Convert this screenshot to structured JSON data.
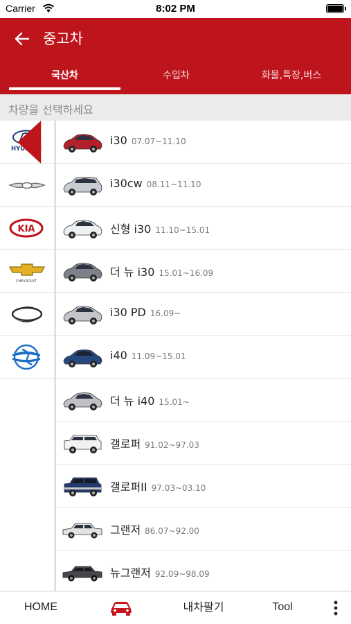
{
  "status_bar": {
    "carrier": "Carrier",
    "time": "8:02 PM"
  },
  "header": {
    "title": "중고차",
    "tabs": [
      {
        "label": "국산차",
        "selected": true
      },
      {
        "label": "수입차",
        "selected": false
      },
      {
        "label": "화물,특장,버스",
        "selected": false
      }
    ]
  },
  "hint": "차량을 선택하세요",
  "brands": [
    {
      "name": "hyundai-logo",
      "wordmark": "HYUNDAI",
      "selected": true
    },
    {
      "name": "genesis-logo",
      "selected": false
    },
    {
      "name": "kia-logo",
      "wordmark": "KIA",
      "selected": false
    },
    {
      "name": "chevrolet-logo",
      "wordmark": "CHEVROLET",
      "selected": false
    },
    {
      "name": "renault-samsung-logo",
      "selected": false
    },
    {
      "name": "ssangyong-logo",
      "selected": false
    }
  ],
  "cars": [
    {
      "name": "i30",
      "period": "07.07~11.10",
      "color": "#b3202a"
    },
    {
      "name": "i30cw",
      "period": "08.11~11.10",
      "color": "#c9ccd2"
    },
    {
      "name": "신형 i30",
      "period": "11.10~15.01",
      "color": "#eef0f2"
    },
    {
      "name": "더 뉴 i30",
      "period": "15.01~16.09",
      "color": "#7d8088"
    },
    {
      "name": "i30 PD",
      "period": "16.09~",
      "color": "#c3c5c8"
    },
    {
      "name": "i40",
      "period": "11.09~15.01",
      "color": "#27487e"
    },
    {
      "name": "더 뉴 i40",
      "period": "15.01~",
      "color": "#bfc1c4"
    },
    {
      "name": "갤로퍼",
      "period": "91.02~97.03",
      "color": "#f2f2f2"
    },
    {
      "name": "갤로퍼II",
      "period": "97.03~03.10",
      "color": "#243a6e"
    },
    {
      "name": "그랜저",
      "period": "86.07~92.00",
      "color": "#e2e2e2"
    },
    {
      "name": "뉴그랜저",
      "period": "92.09~98.09",
      "color": "#45474d"
    }
  ],
  "bottom_nav": {
    "home": "HOME",
    "car_icon": "car-icon",
    "sell": "내차팔기",
    "tool": "Tool",
    "more_icon": "more-vertical-icon"
  },
  "colors": {
    "brand_red": "#be141c",
    "hint_bg": "#ebebeb"
  }
}
